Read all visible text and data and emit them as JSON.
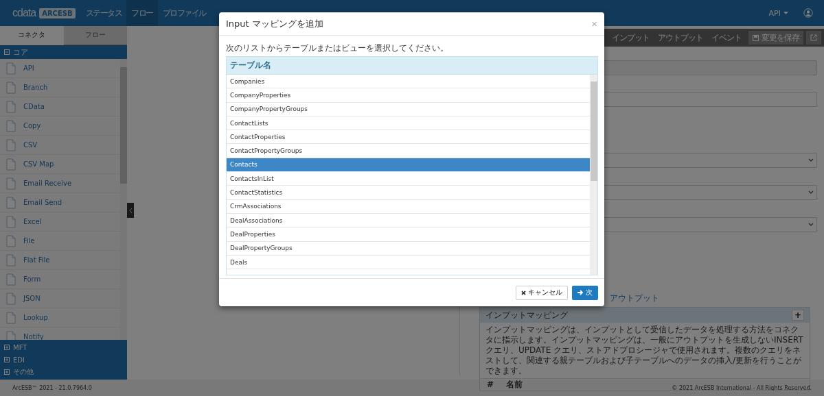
{
  "header": {
    "logo": "cdata",
    "product": "ARCESB",
    "nav": [
      {
        "label": "ステータス",
        "selected": false
      },
      {
        "label": "フロー",
        "selected": true
      },
      {
        "label": "プロファイル",
        "selected": false
      }
    ],
    "user_menu": "API"
  },
  "sidebar": {
    "tabs": [
      {
        "label": "コネクタ",
        "selected": true
      },
      {
        "label": "フロー",
        "selected": false
      }
    ],
    "open_category": "コア",
    "items": [
      "API",
      "Branch",
      "CData",
      "Copy",
      "CSV",
      "CSV Map",
      "Email Receive",
      "Email Send",
      "Excel",
      "File",
      "Flat File",
      "Form",
      "JSON",
      "Lookup",
      "Notify"
    ],
    "closed_categories": [
      "MFT",
      "EDI",
      "その他"
    ]
  },
  "panel": {
    "tabs": [
      {
        "label": "インプット",
        "selected": false
      },
      {
        "label": "アウトプット",
        "selected": false
      },
      {
        "label": "イベント",
        "selected": false
      }
    ],
    "save_button": "変更を保存",
    "link": "アウトプット",
    "mapping_card": {
      "title": "インプットマッピング",
      "add_button": "+",
      "description": "インプットマッピングは、インプットとして受信したデータを処理する方法をコネクタに指示します。インプットマッピングは、一般にアウトプットを生成しないINSERT クエリ、UPDATE クエリ、ストアドプロシージャで使用されます。複数のクエリをネストして、関連する親テーブルおよび子テーブルへのデータの挿入/更新を行うことができます。",
      "columns": [
        "#",
        "名前"
      ]
    }
  },
  "modal": {
    "title": "Input マッピングを追加",
    "close": "×",
    "instruction": "次のリストからテーブルまたはビューを選択してください。",
    "column": "テーブル名",
    "rows": [
      {
        "name": "Companies",
        "selected": false
      },
      {
        "name": "CompanyProperties",
        "selected": false
      },
      {
        "name": "CompanyPropertyGroups",
        "selected": false
      },
      {
        "name": "ContactLists",
        "selected": false
      },
      {
        "name": "ContactProperties",
        "selected": false
      },
      {
        "name": "ContactPropertyGroups",
        "selected": false
      },
      {
        "name": "Contacts",
        "selected": true
      },
      {
        "name": "ContactsInList",
        "selected": false
      },
      {
        "name": "ContactStatistics",
        "selected": false
      },
      {
        "name": "CrmAssociations",
        "selected": false
      },
      {
        "name": "DealAssociations",
        "selected": false
      },
      {
        "name": "DealProperties",
        "selected": false
      },
      {
        "name": "DealPropertyGroups",
        "selected": false
      },
      {
        "name": "Deals",
        "selected": false
      }
    ],
    "cancel_button": "キャンセル",
    "next_button": "次"
  },
  "footer": {
    "version": "ArcESB™ 2021 - 21.0.7964.0",
    "copyright": "© 2021 ArcESB International - All Rights Reserved."
  }
}
